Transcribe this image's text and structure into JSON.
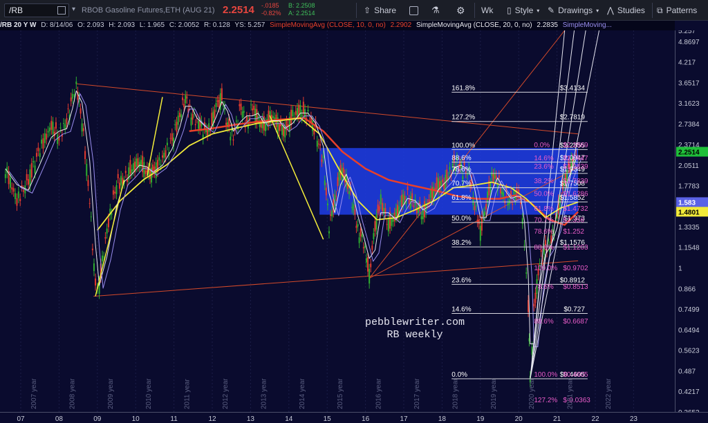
{
  "toolbar": {
    "symbol": "/RB",
    "instrument": "RBOB Gasoline Futures,ETH (AUG 21)",
    "last": "2.2514",
    "change": "-.0185",
    "change_pct": "-0.82%",
    "bid": "B: 2.2508",
    "ask": "A: 2.2514",
    "share": "Share",
    "interval": "Wk",
    "style": "Style",
    "drawings": "Drawings",
    "studies": "Studies",
    "patterns": "Patterns"
  },
  "legend": {
    "symbol_info": "/RB 20 Y W",
    "date": "D: 8/14/06",
    "open": "O: 2.093",
    "high": "H: 2.093",
    "low": "L: 1.965",
    "close": "C: 2.0052",
    "range": "R: 0.128",
    "ys": "YS: 5.257",
    "sma10_label": "SimpleMovingAvg (CLOSE, 10, 0, no)",
    "sma10_value": "2.2902",
    "sma20_label": "SimpleMovingAvg (CLOSE, 20, 0, no)",
    "sma20_value": "2.2835",
    "sma3_label": "SimpleMoving..."
  },
  "watermark": {
    "line1": "pebblewriter.com",
    "line2": "RB weekly"
  },
  "colors": {
    "background": "#0a0b2e",
    "candle_up": "#2fae2f",
    "candle_down": "#e23b2e",
    "sma_red": "#e8402a",
    "sma_yellow": "#f2ea3a",
    "sma_white": "#e8e8ee",
    "sma_violet": "#9a8ef0",
    "blue_zone": "#1f3ee8",
    "fib_line": "#d8d8e0",
    "fib_text_pink": "#e85cc8",
    "trend_line": "#d44a2a",
    "yellow_annotation": "#f4ee3a"
  },
  "chart_data": {
    "type": "candlestick",
    "scale": "log",
    "ylim": [
      0.3652,
      5.257
    ],
    "x_ticks": [
      "07",
      "08",
      "09",
      "10",
      "11",
      "12",
      "13",
      "14",
      "15",
      "16",
      "17",
      "18",
      "19",
      "20",
      "21",
      "22",
      "23"
    ],
    "year_labels": [
      "2006 year",
      "2007 year",
      "2008 year",
      "2009 year",
      "2010 year",
      "2011 year",
      "2012 year",
      "2013 year",
      "2014 year",
      "2015 year",
      "2016 year",
      "2017 year",
      "2018 year",
      "2019 year",
      "2020 year",
      "2021 year",
      "2022 year"
    ],
    "y_ticks": [
      "5.257",
      "4.8697",
      "4.217",
      "3.6517",
      "3.1623",
      "2.7384",
      "2.3714",
      "2.0511",
      "1.7783",
      "1.5399",
      "1.3335",
      "1.1548",
      "1",
      "0.866",
      "0.7499",
      "0.6494",
      "0.5623",
      "0.487",
      "0.4217",
      "0.3652"
    ],
    "price_markers": [
      {
        "label": "2.2514",
        "value": 2.2514,
        "color": "#1fbf3a"
      },
      {
        "label": "1.583",
        "value": 1.583,
        "color": "#5a62e6"
      },
      {
        "label": "1.4801",
        "value": 1.4801,
        "color": "#f2ea3a"
      }
    ],
    "series_points": [
      [
        2006.6,
        2.0
      ],
      [
        2006.9,
        1.6
      ],
      [
        2007.2,
        1.85
      ],
      [
        2007.5,
        2.3
      ],
      [
        2007.8,
        2.7
      ],
      [
        2008.0,
        2.5
      ],
      [
        2008.2,
        2.8
      ],
      [
        2008.35,
        3.3
      ],
      [
        2008.45,
        3.6
      ],
      [
        2008.6,
        2.8
      ],
      [
        2008.8,
        1.6
      ],
      [
        2008.95,
        0.87
      ],
      [
        2009.05,
        0.9
      ],
      [
        2009.25,
        1.3
      ],
      [
        2009.5,
        1.8
      ],
      [
        2009.7,
        1.85
      ],
      [
        2009.9,
        2.0
      ],
      [
        2010.1,
        2.1
      ],
      [
        2010.3,
        1.95
      ],
      [
        2010.45,
        1.95
      ],
      [
        2010.7,
        2.15
      ],
      [
        2010.95,
        2.45
      ],
      [
        2011.15,
        2.9
      ],
      [
        2011.3,
        3.3
      ],
      [
        2011.45,
        2.9
      ],
      [
        2011.6,
        2.8
      ],
      [
        2011.8,
        2.6
      ],
      [
        2011.95,
        2.65
      ],
      [
        2012.1,
        3.1
      ],
      [
        2012.25,
        3.3
      ],
      [
        2012.4,
        2.7
      ],
      [
        2012.55,
        2.5
      ],
      [
        2012.75,
        3.1
      ],
      [
        2012.9,
        2.7
      ],
      [
        2013.05,
        3.1
      ],
      [
        2013.2,
        2.8
      ],
      [
        2013.35,
        2.7
      ],
      [
        2013.55,
        2.9
      ],
      [
        2013.75,
        2.7
      ],
      [
        2013.9,
        2.6
      ],
      [
        2014.1,
        2.9
      ],
      [
        2014.3,
        3.0
      ],
      [
        2014.5,
        2.9
      ],
      [
        2014.7,
        2.6
      ],
      [
        2014.9,
        2.1
      ],
      [
        2015.05,
        1.35
      ],
      [
        2015.2,
        1.6
      ],
      [
        2015.35,
        2.0
      ],
      [
        2015.5,
        1.85
      ],
      [
        2015.65,
        1.6
      ],
      [
        2015.8,
        1.3
      ],
      [
        2015.95,
        1.2
      ],
      [
        2016.1,
        0.95
      ],
      [
        2016.25,
        1.35
      ],
      [
        2016.4,
        1.6
      ],
      [
        2016.6,
        1.35
      ],
      [
        2016.8,
        1.45
      ],
      [
        2016.95,
        1.6
      ],
      [
        2017.1,
        1.65
      ],
      [
        2017.3,
        1.55
      ],
      [
        2017.5,
        1.45
      ],
      [
        2017.7,
        1.65
      ],
      [
        2017.9,
        1.8
      ],
      [
        2018.05,
        1.8
      ],
      [
        2018.2,
        1.95
      ],
      [
        2018.35,
        2.1
      ],
      [
        2018.5,
        2.0
      ],
      [
        2018.7,
        1.95
      ],
      [
        2018.85,
        1.55
      ],
      [
        2019.0,
        1.3
      ],
      [
        2019.15,
        1.55
      ],
      [
        2019.3,
        1.9
      ],
      [
        2019.45,
        1.85
      ],
      [
        2019.6,
        1.65
      ],
      [
        2019.8,
        1.6
      ],
      [
        2019.95,
        1.7
      ],
      [
        2020.05,
        1.6
      ],
      [
        2020.15,
        1.2
      ],
      [
        2020.25,
        0.75
      ],
      [
        2020.3,
        0.4605
      ],
      [
        2020.4,
        0.75
      ],
      [
        2020.55,
        1.05
      ],
      [
        2020.7,
        1.15
      ],
      [
        2020.85,
        1.2
      ],
      [
        2021.0,
        1.45
      ],
      [
        2021.15,
        1.75
      ],
      [
        2021.3,
        2.0
      ],
      [
        2021.45,
        2.15
      ],
      [
        2021.55,
        2.2514
      ]
    ],
    "moving_averages": {
      "red": [
        [
          2011.4,
          2.6
        ],
        [
          2012.0,
          2.65
        ],
        [
          2012.6,
          2.72
        ],
        [
          2013.2,
          2.78
        ],
        [
          2013.8,
          2.82
        ],
        [
          2014.4,
          2.85
        ],
        [
          2014.9,
          2.6
        ],
        [
          2015.4,
          2.25
        ],
        [
          2016.0,
          2.0
        ],
        [
          2016.6,
          1.85
        ],
        [
          2017.2,
          1.78
        ],
        [
          2017.8,
          1.72
        ],
        [
          2018.4,
          1.65
        ],
        [
          2018.9,
          1.62
        ],
        [
          2019.5,
          1.62
        ],
        [
          2019.9,
          1.66
        ],
        [
          2020.3,
          1.58
        ],
        [
          2020.8,
          1.4
        ],
        [
          2021.2,
          1.35
        ],
        [
          2021.55,
          1.4801
        ]
      ],
      "yellow": [
        [
          2009.0,
          1.3
        ],
        [
          2009.6,
          1.6
        ],
        [
          2010.2,
          1.85
        ],
        [
          2010.8,
          2.05
        ],
        [
          2011.4,
          2.35
        ],
        [
          2012.0,
          2.55
        ],
        [
          2012.6,
          2.65
        ],
        [
          2013.2,
          2.75
        ],
        [
          2013.8,
          2.8
        ],
        [
          2014.3,
          2.85
        ],
        [
          2014.8,
          2.55
        ],
        [
          2015.3,
          2.0
        ],
        [
          2015.8,
          1.6
        ],
        [
          2016.3,
          1.4
        ],
        [
          2016.8,
          1.42
        ],
        [
          2017.3,
          1.5
        ],
        [
          2017.8,
          1.6
        ],
        [
          2018.3,
          1.75
        ],
        [
          2018.8,
          1.78
        ],
        [
          2019.3,
          1.82
        ],
        [
          2019.8,
          1.75
        ],
        [
          2020.2,
          1.62
        ],
        [
          2020.7,
          1.42
        ],
        [
          2021.1,
          1.52
        ],
        [
          2021.55,
          1.583
        ]
      ]
    },
    "fib_left": [
      {
        "label": "161.8%",
        "price": "$3.4134",
        "value": 3.4134
      },
      {
        "label": "127.2%",
        "price": "$2.7819",
        "value": 2.7819
      },
      {
        "label": "100.0%",
        "price": "$2.2855",
        "value": 2.2855
      },
      {
        "label": "88.6%",
        "price": "$2.0947",
        "value": 2.0947
      },
      {
        "label": "78.6%",
        "price": "$1.9349",
        "value": 1.9349
      },
      {
        "label": "70.7%",
        "price": "$1.7508",
        "value": 1.7508
      },
      {
        "label": "61.8%",
        "price": "$1.5852",
        "value": 1.5852
      },
      {
        "label": "50.0%",
        "price": "$1.373",
        "value": 1.373
      },
      {
        "label": "38.2%",
        "price": "$1.1576",
        "value": 1.1576
      },
      {
        "label": "23.6%",
        "price": "$0.8912",
        "value": 0.8912
      },
      {
        "label": "14.6%",
        "price": "$0.727",
        "value": 0.727
      },
      {
        "label": "0.0%",
        "price": "$0.4605",
        "value": 0.4605
      }
    ],
    "fib_right": [
      {
        "label": "0.0%",
        "price": "$2.2869",
        "value": 2.29
      },
      {
        "label": "14.6%",
        "price": "$2.0947",
        "value": 2.09
      },
      {
        "label": "23.6%",
        "price": "$1.9839",
        "value": 1.97
      },
      {
        "label": "38.2%",
        "price": "$1.7839",
        "value": 1.78
      },
      {
        "label": "50.0%",
        "price": "$1.6286",
        "value": 1.63
      },
      {
        "label": "61.8%",
        "price": "$1.4732",
        "value": 1.47
      },
      {
        "label": "70.7%",
        "price": "$1.356",
        "value": 1.356
      },
      {
        "label": "78.6%",
        "price": "$1.252",
        "value": 1.252
      },
      {
        "label": "88.6%",
        "price": "$1.1203",
        "value": 1.1203
      },
      {
        "label": "100.0%",
        "price": "$0.9702",
        "value": 0.9702
      },
      {
        "label": "78.6%",
        "price": "$0.8513",
        "value": 0.8513
      },
      {
        "label": "88.6%",
        "price": "$0.6687",
        "value": 0.6687
      },
      {
        "label": "100.0%",
        "price": "$0.4605",
        "value": 0.4605
      },
      {
        "label": "127.2%",
        "price": "$-0.0363",
        "value": 0.385
      }
    ]
  }
}
